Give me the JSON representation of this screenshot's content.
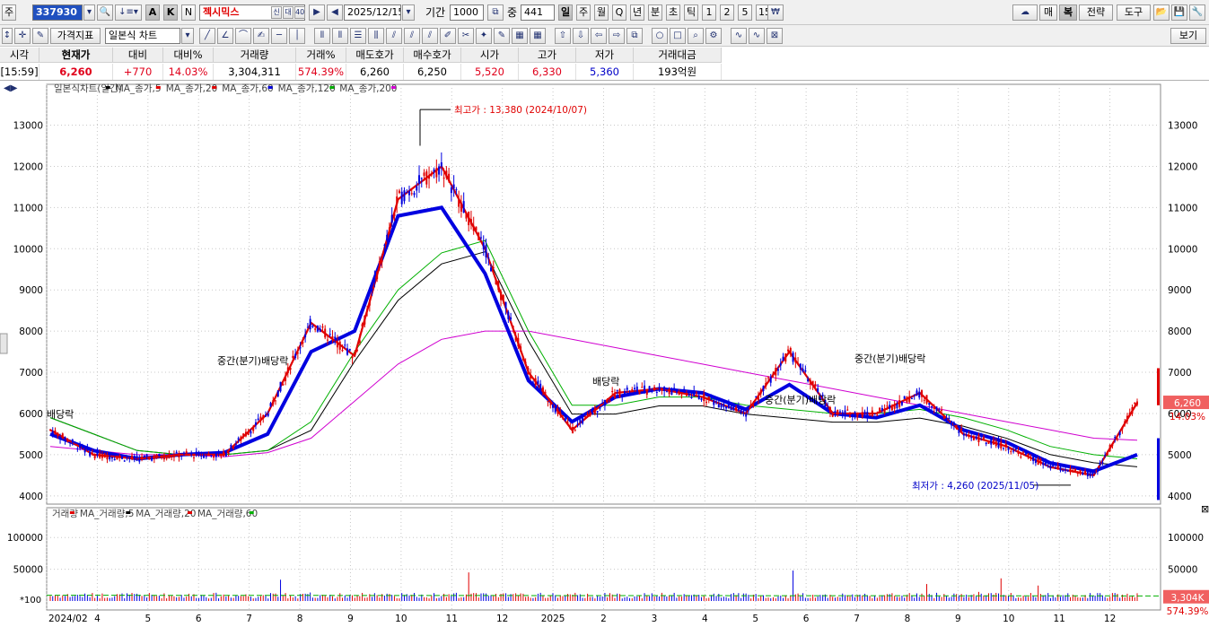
{
  "toolbar": {
    "market_label": "주",
    "code": "337930",
    "mode_a": "A",
    "mode_k": "K",
    "mode_n": "N",
    "stock_name": "젝시믹스",
    "date": "2025/12/15",
    "period_label": "기간",
    "period_value": "1000",
    "count_label": "중",
    "count_value": "441",
    "tf_buttons": [
      "일",
      "주",
      "월",
      "Q",
      "년",
      "분",
      "초",
      "틱",
      "1",
      "2",
      "5",
      "15"
    ],
    "right_buttons": [
      "매",
      "복",
      "전략",
      "도구"
    ],
    "row2_price_index": "가격지표",
    "row2_chart_type": "일본식 차트",
    "row2_view": "보기"
  },
  "quote": {
    "headers": [
      "시각",
      "현재가",
      "대비",
      "대비%",
      "거래량",
      "거래%",
      "매도호가",
      "매수호가",
      "시가",
      "고가",
      "저가",
      "거래대금"
    ],
    "values": [
      "[15:59]",
      "6,260",
      "+770",
      "14.03%",
      "3,304,311",
      "574.39%",
      "6,260",
      "6,250",
      "5,520",
      "6,330",
      "5,360",
      "193억원"
    ]
  },
  "chart": {
    "legend_price": [
      {
        "text": "일본식차트(일간)",
        "color": "#000000"
      },
      {
        "text": "MA_종가,5",
        "color": "#e00000"
      },
      {
        "text": "MA_종가,20",
        "color": "#e00000"
      },
      {
        "text": "MA_종가,60",
        "color": "#0000e0"
      },
      {
        "text": "MA_종가,120",
        "color": "#00b000"
      },
      {
        "text": "MA_종가,200",
        "color": "#d000d0"
      }
    ],
    "legend_volume": [
      {
        "text": "거래량",
        "color": "#e00000"
      },
      {
        "text": "MA_거래량,5",
        "color": "#000000"
      },
      {
        "text": "MA_거래량,20",
        "color": "#e00000"
      },
      {
        "text": "MA_거래량,60",
        "color": "#00b000"
      }
    ],
    "max_label": "최고가 : 13,380 (2024/10/07)",
    "min_label": "최저가 : 4,260 (2025/11/05)",
    "annotations": [
      "배당락",
      "중간(분기)배당락",
      "배당락",
      "중간(분기)배당락",
      "중간(분기)배당락"
    ],
    "price_ticks": [
      "13000",
      "12000",
      "11000",
      "10000",
      "9000",
      "8000",
      "7000",
      "6000",
      "5000",
      "4000"
    ],
    "volume_ticks": [
      "100000",
      "50000"
    ],
    "volume_scale": "*100",
    "x_ticks": [
      "2024/02",
      "4",
      "5",
      "6",
      "7",
      "8",
      "9",
      "10",
      "11",
      "12",
      "2025",
      "2",
      "3",
      "4",
      "5",
      "6",
      "7",
      "8",
      "9",
      "10",
      "11",
      "12"
    ],
    "current_price_tag": "6,260",
    "current_change_tag": "14.03%",
    "current_volume_tag": "3,304K",
    "current_volume_pct_tag": "574.39%",
    "colors": {
      "up": "#e00000",
      "down": "#0000e0",
      "ma120": "#00b000",
      "ma200": "#d000d0",
      "ma90": "#000000",
      "grid": "#c8c8c8",
      "tag": "#f06060"
    }
  },
  "chart_data": {
    "type": "line",
    "series": [
      {
        "name": "MA_종가,5",
        "values": [
          5600,
          5000,
          4900,
          5000,
          5000,
          6000,
          8200,
          7400,
          11200,
          12000,
          10000,
          7000,
          5600,
          6500,
          6600,
          6400,
          6000,
          7500,
          6000,
          6000,
          6500,
          5500,
          5200,
          4700,
          4500,
          6260
        ]
      },
      {
        "name": "MA_종가,60",
        "values": [
          5500,
          5100,
          4900,
          5000,
          5050,
          5500,
          7500,
          8000,
          10800,
          11000,
          9400,
          6800,
          5800,
          6400,
          6600,
          6500,
          6100,
          6700,
          6000,
          5900,
          6200,
          5600,
          5300,
          4800,
          4600,
          5000
        ]
      },
      {
        "name": "MA_종가,120",
        "values": [
          5900,
          5500,
          5100,
          5000,
          5000,
          5100,
          5800,
          7500,
          9000,
          9900,
          10200,
          8000,
          6200,
          6200,
          6400,
          6400,
          6200,
          6100,
          6000,
          6000,
          6100,
          5900,
          5600,
          5200,
          5000,
          4900
        ]
      },
      {
        "name": "MA_종가,200",
        "values": [
          5200,
          5100,
          5000,
          5000,
          4950,
          5050,
          5400,
          6300,
          7200,
          7800,
          8000,
          8000,
          7800,
          7600,
          7400,
          7200,
          7000,
          6800,
          6600,
          6400,
          6200,
          6000,
          5800,
          5600,
          5400,
          5350
        ]
      }
    ],
    "x": [
      "2024/02",
      "4",
      "5",
      "6",
      "7",
      "8",
      "9",
      "10",
      "11",
      "12",
      "2025",
      "2",
      "3",
      "4",
      "5",
      "6",
      "7",
      "8",
      "9",
      "10",
      "11",
      "12"
    ],
    "ylim": [
      3800,
      13600
    ]
  }
}
